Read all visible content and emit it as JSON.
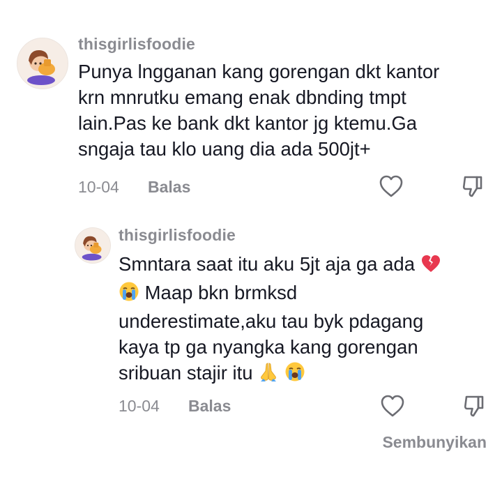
{
  "comment": {
    "username": "thisgirlisfoodie",
    "lines": [
      "Punya lngganan kang gorengan dkt kantor",
      "krn mnrutku emang enak dbnding tmpt",
      "lain.Pas ke bank dkt kantor jg ktemu.Ga",
      "sngaja tau klo uang dia ada 500jt+"
    ],
    "date": "10-04",
    "reply_label": "Balas",
    "like_icon": "heart-outline-icon",
    "dislike_icon": "thumbs-down-outline-icon"
  },
  "reply": {
    "username": "thisgirlisfoodie",
    "line1": "Smntara saat itu aku 5jt aja ga ada",
    "line2": "Maap bkn brmksd",
    "line3": "underestimate,aku tau byk pdagang",
    "line4": "kaya tp ga nyangka kang gorengan",
    "line5": "sribuan stajir itu",
    "emoji_icons": [
      "broken-heart-icon",
      "loudly-crying-face-icon",
      "folded-hands-icon",
      "loudly-crying-face-icon"
    ],
    "date": "10-04",
    "reply_label": "Balas"
  },
  "hide_label": "Sembunyikan",
  "colors": {
    "text": "#161823",
    "muted": "#8a8b91",
    "broken_heart": "#e8384f",
    "emoji_yellow": "#ffc83d"
  }
}
